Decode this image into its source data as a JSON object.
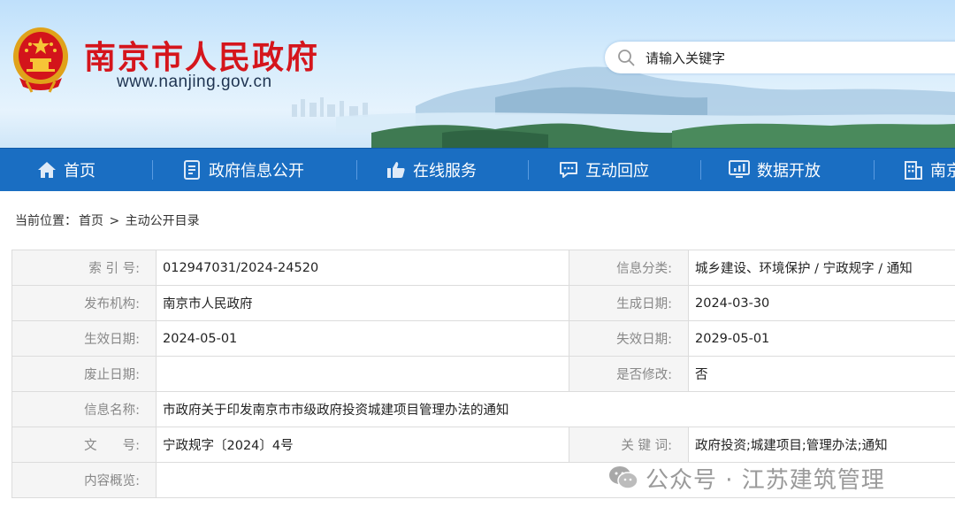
{
  "header": {
    "site_title": "南京市人民政府",
    "site_url": "www.nanjing.gov.cn",
    "search_placeholder": "请输入关键字"
  },
  "nav": {
    "items": [
      {
        "label": "首页",
        "icon": "home-icon"
      },
      {
        "label": "政府信息公开",
        "icon": "document-icon"
      },
      {
        "label": "在线服务",
        "icon": "thumbs-up-icon"
      },
      {
        "label": "互动回应",
        "icon": "chat-icon"
      },
      {
        "label": "数据开放",
        "icon": "monitor-icon"
      },
      {
        "label": "南京",
        "icon": "building-icon"
      }
    ]
  },
  "breadcrumb": {
    "prefix": "当前位置：",
    "home": "首页",
    "separator": ">",
    "current": "主动公开目录"
  },
  "info": {
    "rows": [
      {
        "label1": "索 引 号:",
        "value1": "012947031/2024-24520",
        "label2": "信息分类:",
        "value2": "城乡建设、环境保护 / 宁政规字 / 通知"
      },
      {
        "label1": "发布机构:",
        "value1": "南京市人民政府",
        "label2": "生成日期:",
        "value2": "2024-03-30"
      },
      {
        "label1": "生效日期:",
        "value1": "2024-05-01",
        "label2": "失效日期:",
        "value2": "2029-05-01"
      },
      {
        "label1": "废止日期:",
        "value1": "",
        "label2": "是否修改:",
        "value2": "否"
      }
    ],
    "name_row": {
      "label": "信息名称:",
      "value": "市政府关于印发南京市市级政府投资城建项目管理办法的通知"
    },
    "doc_row": {
      "label1": "文　　号:",
      "value1": "宁政规字〔2024〕4号",
      "label2": "关 键 词:",
      "value2": "政府投资;城建项目;管理办法;通知"
    },
    "summary_row": {
      "label": "内容概览:",
      "value": ""
    }
  },
  "watermark": {
    "text": "公众号 · 江苏建筑管理"
  },
  "colors": {
    "title_red": "#d5151c",
    "nav_blue": "#1a6ec2",
    "label_bg": "#f5f5f5"
  }
}
